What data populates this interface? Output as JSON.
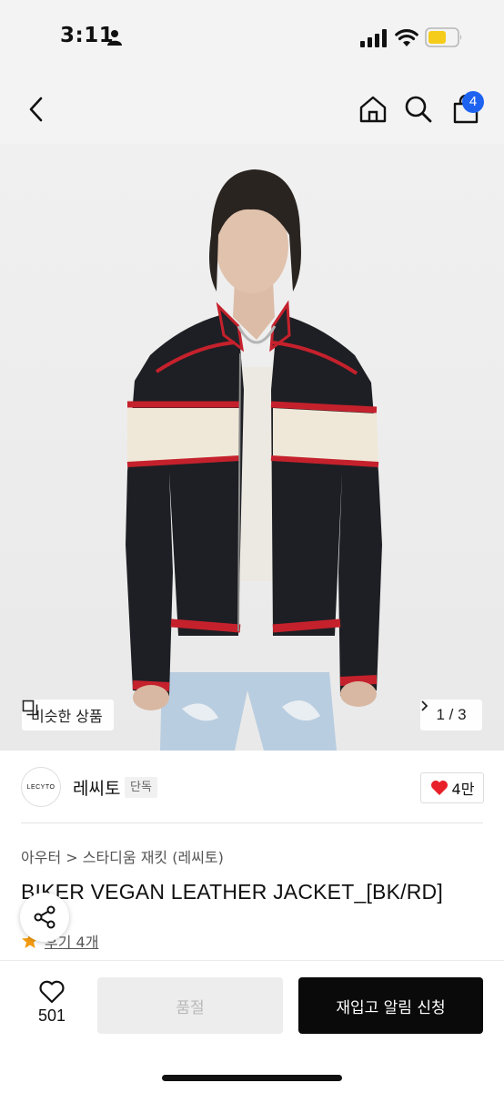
{
  "status_bar": {
    "time": "3:11"
  },
  "nav": {
    "cart_count": "4"
  },
  "hero": {
    "similar_label": "비슷한 상품",
    "page_indicator": "1 / 3"
  },
  "brand": {
    "logo_text": "LECYTO",
    "name": "레씨토",
    "tag": "단독",
    "likes": "4만"
  },
  "product": {
    "category": "아우터  >  스타디움 재킷 (레씨토)",
    "title": "BIKER VEGAN LEATHER JACKET_[BK/RD]",
    "review_link": "후기 4개"
  },
  "bottom": {
    "wish_count": "501",
    "soldout_label": "품절",
    "restock_label": "재입고 알림 신청"
  },
  "colors": {
    "accent_blue": "#1e62f0",
    "heart_red": "#e8202a",
    "star_orange": "#f39c12"
  }
}
